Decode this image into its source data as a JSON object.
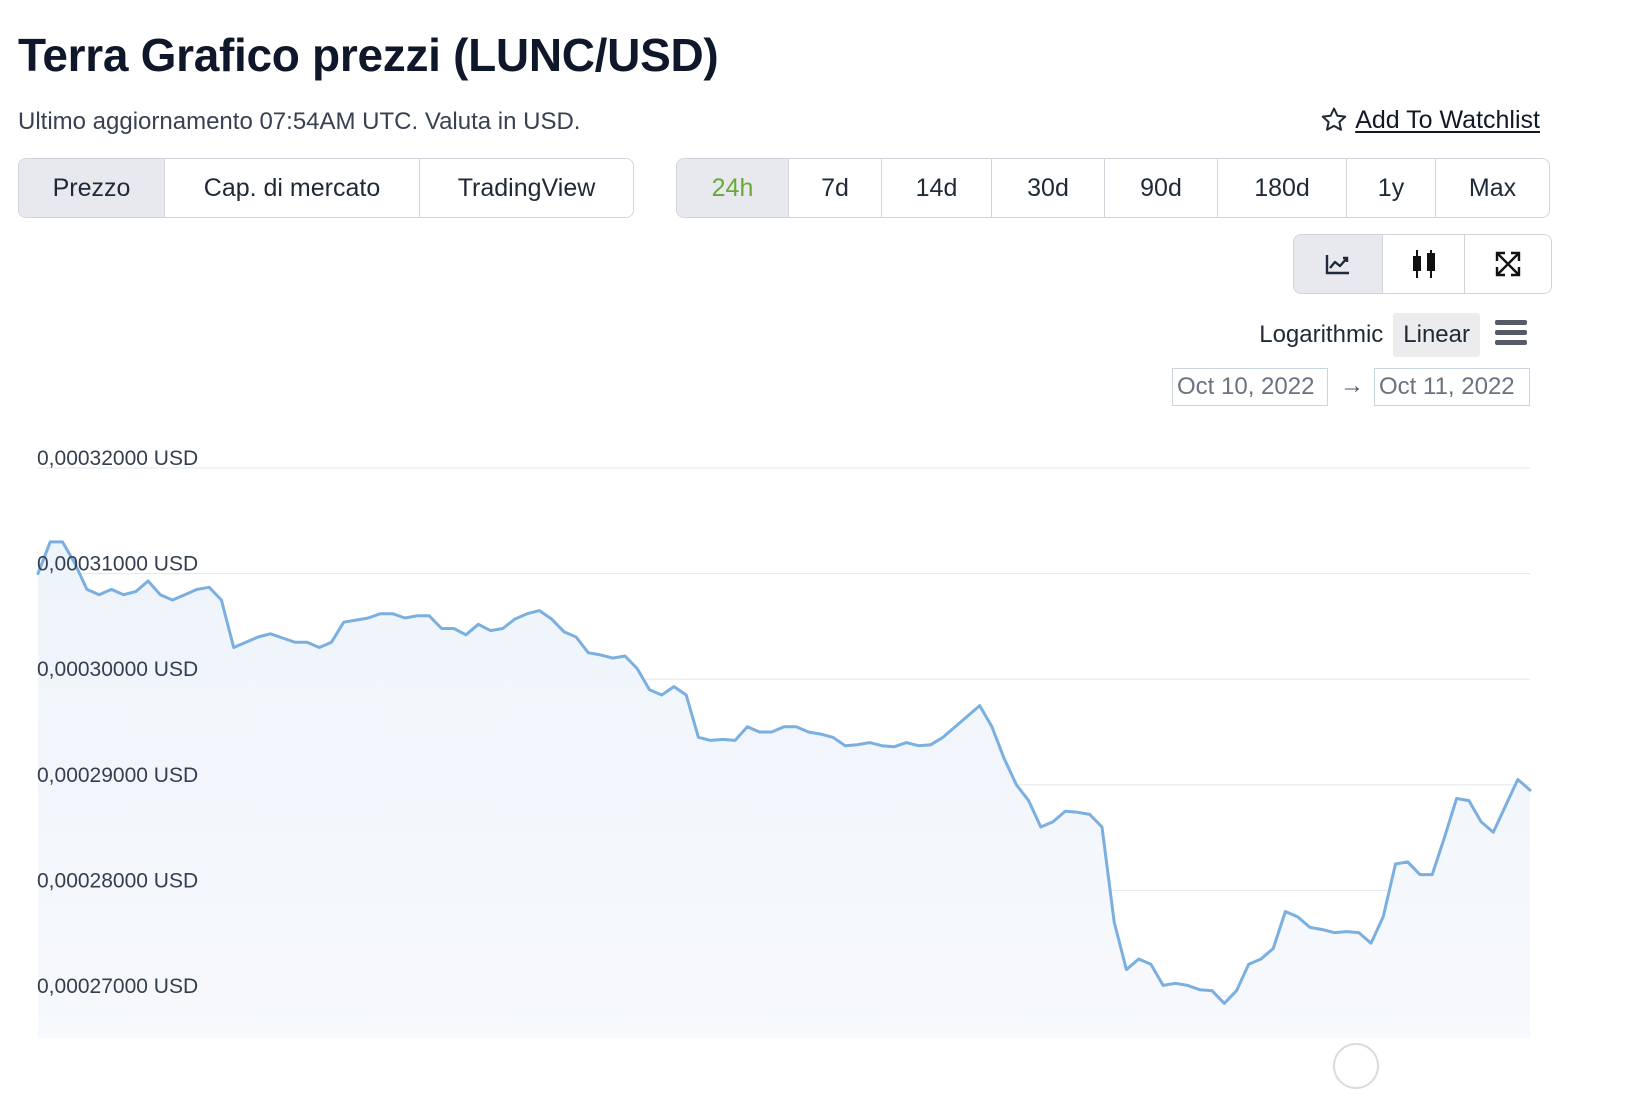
{
  "header": {
    "title": "Terra Grafico prezzi (LUNC/USD)",
    "subtitle": "Ultimo aggiornamento 07:54AM UTC. Valuta in USD.",
    "watchlist_label": "Add To Watchlist",
    "watchlist_icon": "star-outline-icon"
  },
  "tabs": [
    {
      "label": "Prezzo",
      "active": true
    },
    {
      "label": "Cap. di mercato",
      "active": false
    },
    {
      "label": "TradingView",
      "active": false
    }
  ],
  "ranges": [
    {
      "label": "24h",
      "active": true
    },
    {
      "label": "7d",
      "active": false
    },
    {
      "label": "14d",
      "active": false
    },
    {
      "label": "30d",
      "active": false
    },
    {
      "label": "90d",
      "active": false
    },
    {
      "label": "180d",
      "active": false
    },
    {
      "label": "1y",
      "active": false
    },
    {
      "label": "Max",
      "active": false
    }
  ],
  "view_buttons": [
    {
      "icon": "line-chart-icon",
      "active": true
    },
    {
      "icon": "candlestick-icon",
      "active": false
    },
    {
      "icon": "fullscreen-icon",
      "active": false
    }
  ],
  "scale": {
    "logarithmic_label": "Logarithmic",
    "linear_label": "Linear",
    "active": "Linear"
  },
  "menu_icon": "hamburger-menu-icon",
  "date_range": {
    "from": "Oct 10, 2022",
    "to": "Oct 11, 2022",
    "arrow": "→"
  },
  "colors": {
    "line": "#7aafe0",
    "area": "#eef4fb",
    "active_range": "#6aa83a",
    "grid": "#e5e7eb"
  },
  "chart_data": {
    "type": "area",
    "ylim": [
      0.000266,
      0.000321
    ],
    "yticks": [
      {
        "value": 0.00032,
        "label": "0,00032000 USD"
      },
      {
        "value": 0.00031,
        "label": "0,00031000 USD"
      },
      {
        "value": 0.0003,
        "label": "0,00030000 USD"
      },
      {
        "value": 0.00029,
        "label": "0,00029000 USD"
      },
      {
        "value": 0.00028,
        "label": "0,00028000 USD"
      },
      {
        "value": 0.00027,
        "label": "0,00027000 USD"
      }
    ],
    "grid": true,
    "values": [
      0.00031,
      0.000313,
      0.000313,
      0.000311,
      0.0003085,
      0.000308,
      0.0003085,
      0.000308,
      0.0003083,
      0.0003093,
      0.000308,
      0.0003075,
      0.000308,
      0.0003085,
      0.0003087,
      0.0003075,
      0.000303,
      0.0003035,
      0.000304,
      0.0003043,
      0.0003039,
      0.0003035,
      0.0003035,
      0.000303,
      0.0003035,
      0.0003054,
      0.0003056,
      0.0003058,
      0.0003062,
      0.0003062,
      0.0003058,
      0.000306,
      0.000306,
      0.0003048,
      0.0003048,
      0.0003042,
      0.0003052,
      0.0003046,
      0.0003048,
      0.0003057,
      0.0003062,
      0.0003065,
      0.0003057,
      0.0003045,
      0.000304,
      0.0003025,
      0.0003023,
      0.000302,
      0.0003022,
      0.000301,
      0.000299,
      0.0002985,
      0.0002993,
      0.0002985,
      0.0002945,
      0.0002942,
      0.0002943,
      0.0002942,
      0.0002955,
      0.000295,
      0.000295,
      0.0002955,
      0.0002955,
      0.000295,
      0.0002948,
      0.0002945,
      0.0002937,
      0.0002938,
      0.000294,
      0.0002937,
      0.0002936,
      0.000294,
      0.0002937,
      0.0002938,
      0.0002945,
      0.0002955,
      0.0002965,
      0.0002975,
      0.0002955,
      0.0002925,
      0.00029,
      0.0002885,
      0.000286,
      0.0002865,
      0.0002875,
      0.0002874,
      0.0002872,
      0.000286,
      0.000277,
      0.0002725,
      0.0002735,
      0.000273,
      0.000271,
      0.0002712,
      0.000271,
      0.0002706,
      0.0002705,
      0.0002693,
      0.0002705,
      0.000273,
      0.0002735,
      0.0002745,
      0.000278,
      0.0002775,
      0.0002765,
      0.0002763,
      0.000276,
      0.0002761,
      0.000276,
      0.000275,
      0.0002775,
      0.0002825,
      0.0002827,
      0.0002815,
      0.0002815,
      0.000285,
      0.0002887,
      0.0002885,
      0.0002865,
      0.0002855,
      0.000288,
      0.0002905,
      0.0002895
    ]
  }
}
